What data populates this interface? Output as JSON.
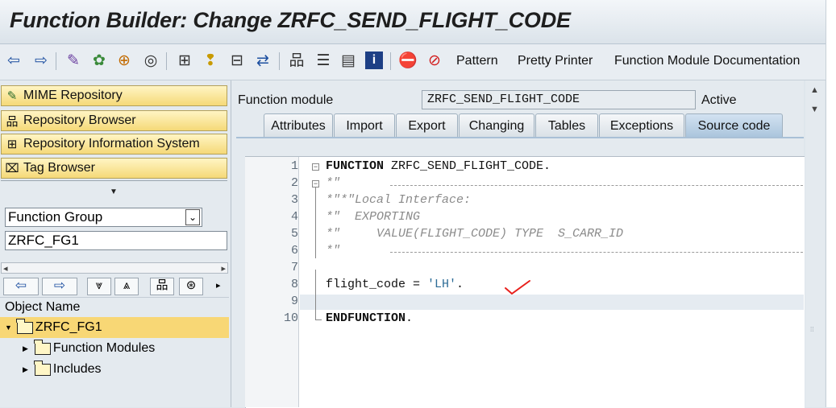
{
  "window": {
    "title": "Function Builder: Change ZRFC_SEND_FLIGHT_CODE"
  },
  "toolbar": {
    "icons": [
      "back-arrow-icon",
      "forward-arrow-icon",
      "display-change-icon",
      "activate-icon",
      "check-icon",
      "where-used-icon",
      "object-list-icon",
      "other-object-icon",
      "hierarchy-icon",
      "display-object-list-icon",
      "navigation-icon",
      "window-icon",
      "info-icon",
      "set-breakpoint-icon",
      "delete-breakpoint-icon"
    ],
    "pattern_label": "Pattern",
    "pretty_printer_label": "Pretty Printer",
    "documentation_label": "Function Module Documentation"
  },
  "sidebar": {
    "nav_buttons": [
      {
        "label": "MIME Repository",
        "icon": "mime-icon"
      },
      {
        "label": "Repository Browser",
        "icon": "repository-browser-icon"
      },
      {
        "label": "Repository Information System",
        "icon": "info-system-icon"
      },
      {
        "label": "Tag Browser",
        "icon": "tag-browser-icon"
      }
    ],
    "object_type": "Function Group",
    "object_value": "ZRFC_FG1",
    "tree_header": "Object Name",
    "tree": [
      {
        "label": "ZRFC_FG1",
        "level": 0,
        "expanded": true
      },
      {
        "label": "Function Modules",
        "level": 1,
        "expanded": false
      },
      {
        "label": "Includes",
        "level": 1,
        "expanded": false
      }
    ]
  },
  "main": {
    "fm_label": "Function module",
    "fm_name": "ZRFC_SEND_FLIGHT_CODE",
    "status": "Active",
    "tabs": [
      "Attributes",
      "Import",
      "Export",
      "Changing",
      "Tables",
      "Exceptions",
      "Source code"
    ],
    "active_tab": "Source code"
  },
  "editor": {
    "line_numbers": [
      "1",
      "2",
      "3",
      "4",
      "5",
      "6",
      "7",
      "8",
      "9",
      "10"
    ],
    "lines": {
      "l1_kw": "FUNCTION",
      "l1_rest": " ZRFC_SEND_FLIGHT_CODE.",
      "l2": "*\"",
      "l3": "*\"*\"Local Interface:",
      "l4": "*\"  EXPORTING",
      "l5": "*\"     VALUE(FLIGHT_CODE) TYPE  S_CARR_ID",
      "l6": "*\"",
      "l8_code": "flight_code = ",
      "l8_str": "'LH'",
      "l8_end": ".",
      "l10_kw": "ENDFUNCTION",
      "l10_end": "."
    },
    "annotation_color": "#e8201c"
  }
}
